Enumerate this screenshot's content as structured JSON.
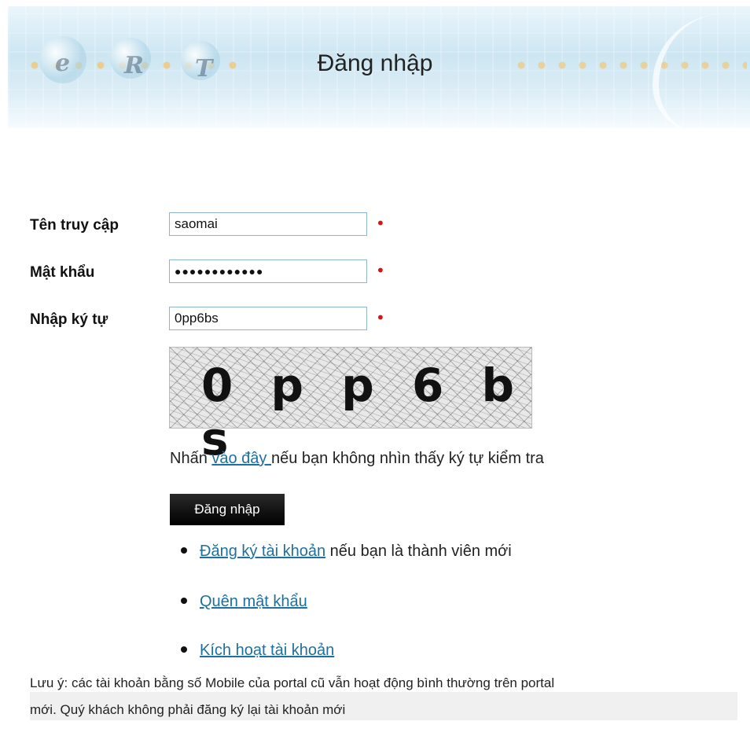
{
  "title": "Đăng nhập",
  "banner": {
    "letters": [
      "e",
      "R",
      "T"
    ]
  },
  "form": {
    "username_label": "Tên truy cập",
    "username_value": "saomai",
    "password_label": "Mật khẩu",
    "password_value": "●●●●●●●●●●●●",
    "captcha_label": "Nhập ký tự",
    "captcha_value": "0pp6bs",
    "required_mark": "•",
    "captcha_image_text": "0 p p 6 b s"
  },
  "help": {
    "prefix": "Nhấn ",
    "link": "vào đây ",
    "suffix": "nếu bạn không nhìn thấy ký tự kiểm tra"
  },
  "submit_label": "Đăng nhập",
  "links": [
    {
      "link": "Đăng ký tài khoản",
      "suffix": " nếu bạn là thành viên mới"
    },
    {
      "link": "Quên mật khẩu",
      "suffix": ""
    },
    {
      "link": "Kích hoạt tài khoản",
      "suffix": ""
    }
  ],
  "note_line1": "Lưu ý: các tài khoản bằng số Mobile của portal cũ vẫn hoạt động bình thường trên portal",
  "note_line2": "mới. Quý khách không phải đăng ký lại tài khoản mới",
  "colors": {
    "link": "#1f6f9f",
    "required": "#dd1111",
    "button": "#000000"
  }
}
